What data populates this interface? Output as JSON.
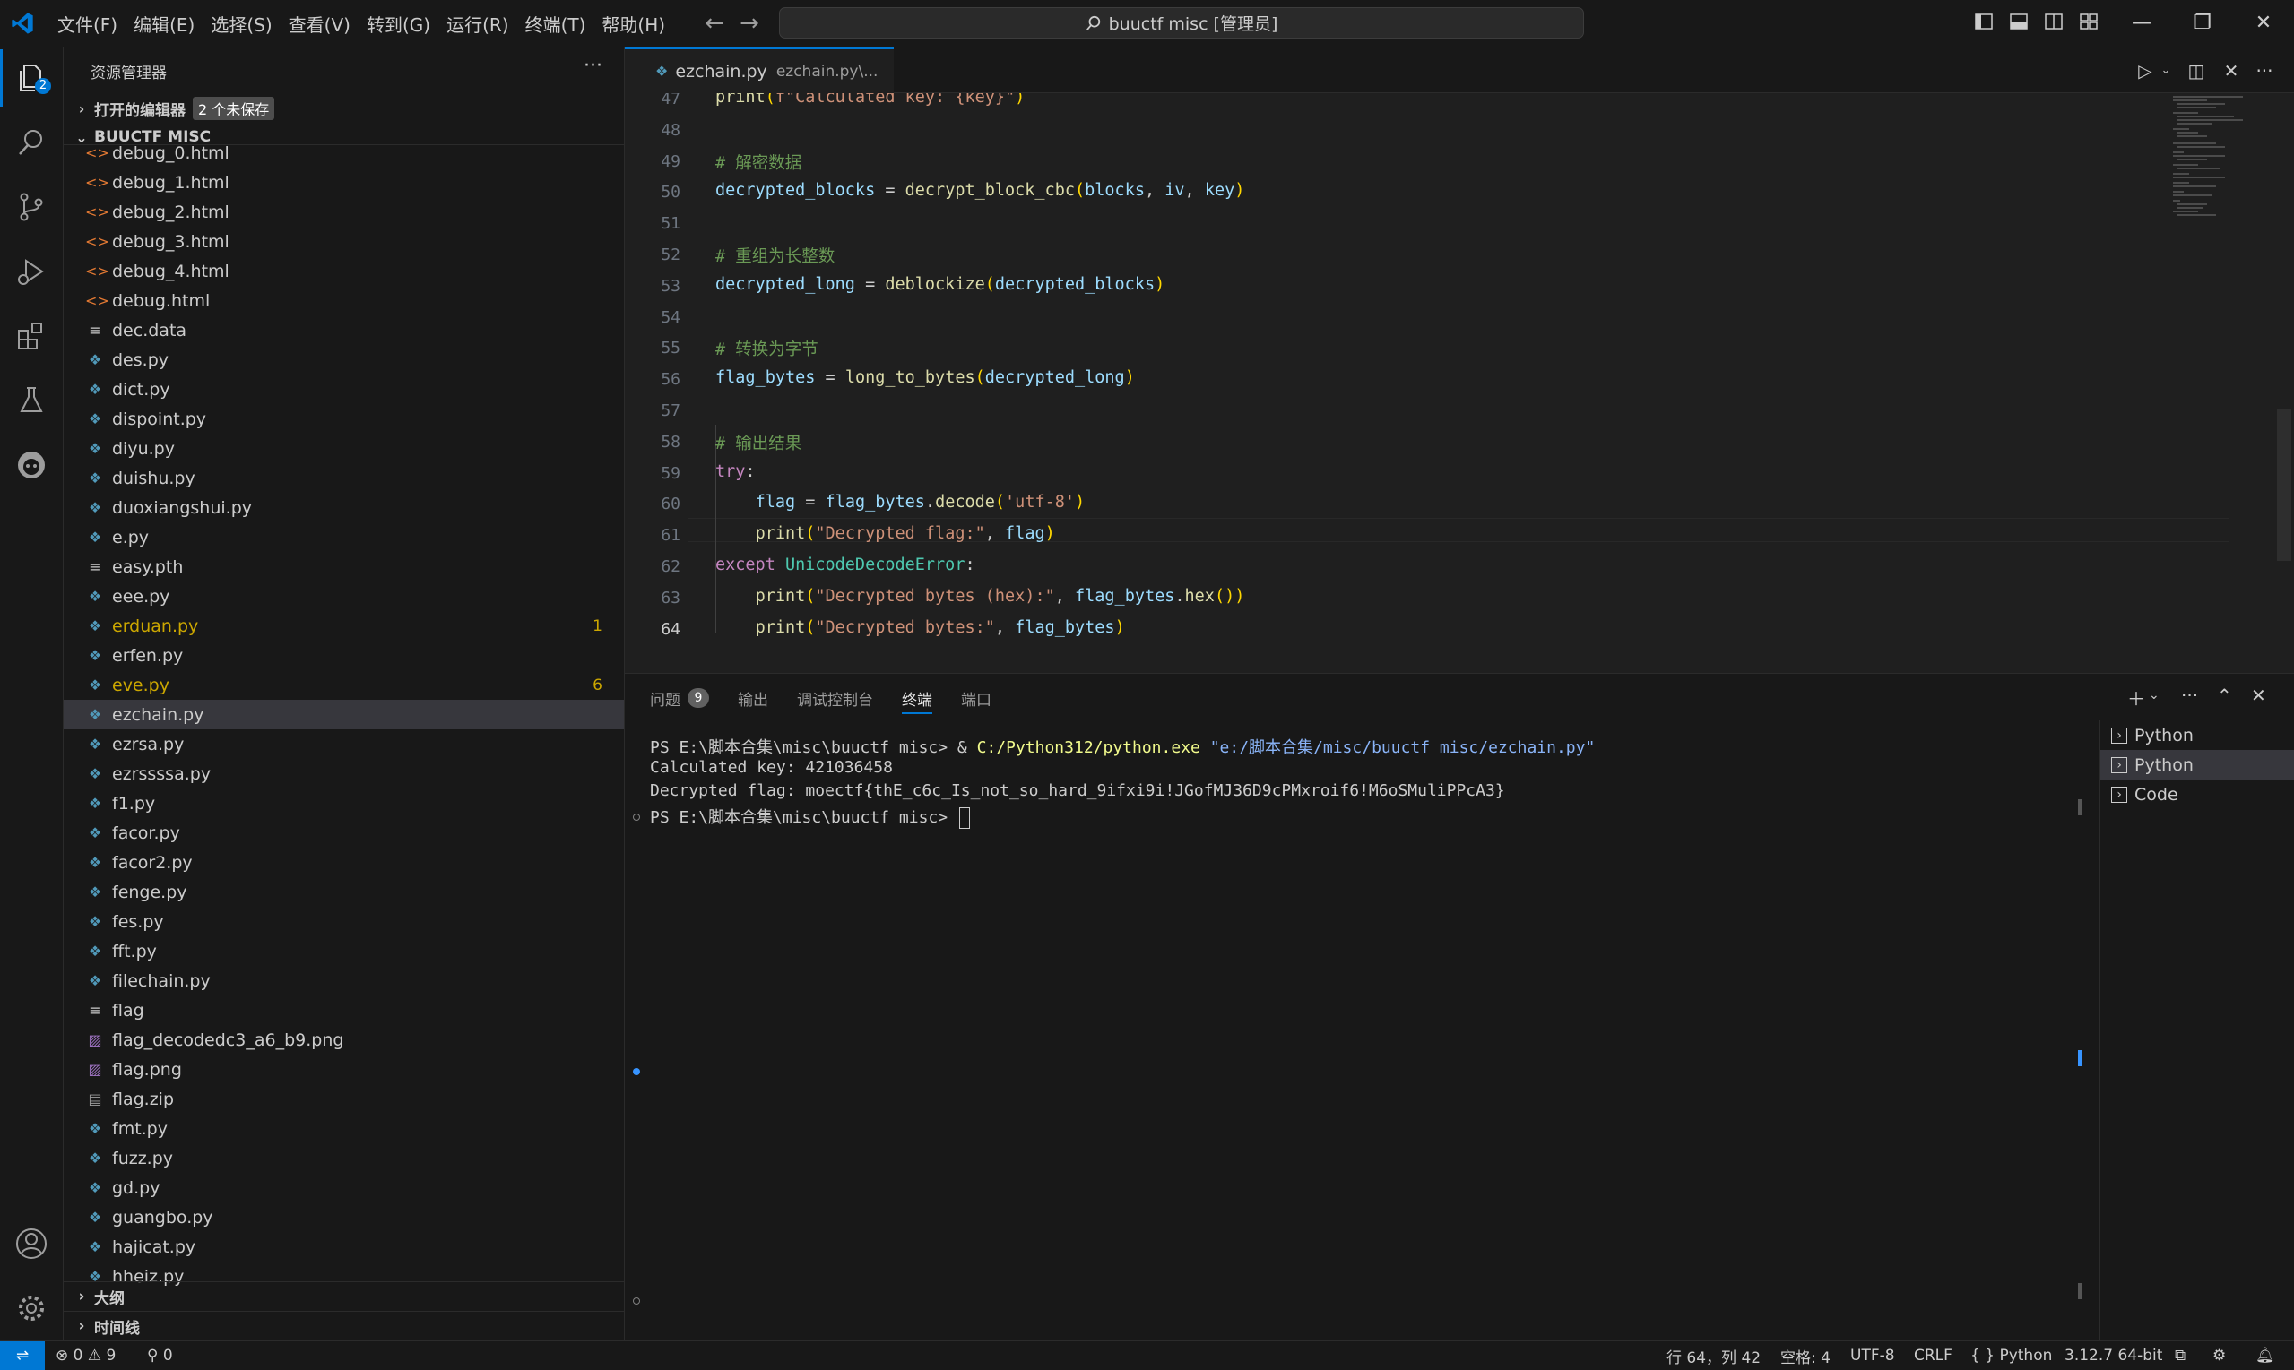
{
  "menu": [
    "文件(F)",
    "编辑(E)",
    "选择(S)",
    "查看(V)",
    "转到(G)",
    "运行(R)",
    "终端(T)",
    "帮助(H)"
  ],
  "command_center": "buuctf misc [管理员]",
  "activity_badge": "2",
  "sidebar": {
    "title": "资源管理器",
    "open_editors": "打开的编辑器",
    "unsaved": "2 个未保存",
    "folder": "BUUCTF MISC",
    "files": [
      {
        "name": "debug_0.html",
        "type": "html",
        "count": ""
      },
      {
        "name": "debug_1.html",
        "type": "html",
        "count": ""
      },
      {
        "name": "debug_2.html",
        "type": "html",
        "count": ""
      },
      {
        "name": "debug_3.html",
        "type": "html",
        "count": ""
      },
      {
        "name": "debug_4.html",
        "type": "html",
        "count": ""
      },
      {
        "name": "debug.html",
        "type": "html",
        "count": ""
      },
      {
        "name": "dec.data",
        "type": "txt",
        "count": ""
      },
      {
        "name": "des.py",
        "type": "py",
        "count": ""
      },
      {
        "name": "dict.py",
        "type": "py",
        "count": ""
      },
      {
        "name": "dispoint.py",
        "type": "py",
        "count": ""
      },
      {
        "name": "diyu.py",
        "type": "py",
        "count": ""
      },
      {
        "name": "duishu.py",
        "type": "py",
        "count": ""
      },
      {
        "name": "duoxiangshui.py",
        "type": "py",
        "count": ""
      },
      {
        "name": "e.py",
        "type": "py",
        "count": ""
      },
      {
        "name": "easy.pth",
        "type": "txt",
        "count": ""
      },
      {
        "name": "eee.py",
        "type": "py",
        "count": ""
      },
      {
        "name": "erduan.py",
        "type": "py",
        "count": "1",
        "warn": true
      },
      {
        "name": "erfen.py",
        "type": "py",
        "count": ""
      },
      {
        "name": "eve.py",
        "type": "py",
        "count": "6",
        "warn": true
      },
      {
        "name": "ezchain.py",
        "type": "py",
        "count": "",
        "selected": true
      },
      {
        "name": "ezrsa.py",
        "type": "py",
        "count": ""
      },
      {
        "name": "ezrssssa.py",
        "type": "py",
        "count": ""
      },
      {
        "name": "f1.py",
        "type": "py",
        "count": ""
      },
      {
        "name": "facor.py",
        "type": "py",
        "count": ""
      },
      {
        "name": "facor2.py",
        "type": "py",
        "count": ""
      },
      {
        "name": "fenge.py",
        "type": "py",
        "count": ""
      },
      {
        "name": "fes.py",
        "type": "py",
        "count": ""
      },
      {
        "name": "fft.py",
        "type": "py",
        "count": ""
      },
      {
        "name": "filechain.py",
        "type": "py",
        "count": ""
      },
      {
        "name": "flag",
        "type": "txt",
        "count": ""
      },
      {
        "name": "flag_decodedc3_a6_b9.png",
        "type": "img",
        "count": ""
      },
      {
        "name": "flag.png",
        "type": "img",
        "count": ""
      },
      {
        "name": "flag.zip",
        "type": "zip",
        "count": ""
      },
      {
        "name": "fmt.py",
        "type": "py",
        "count": ""
      },
      {
        "name": "fuzz.py",
        "type": "py",
        "count": ""
      },
      {
        "name": "gd.py",
        "type": "py",
        "count": ""
      },
      {
        "name": "guangbo.py",
        "type": "py",
        "count": ""
      },
      {
        "name": "hajicat.py",
        "type": "py",
        "count": ""
      },
      {
        "name": "hheiz.py",
        "type": "py",
        "count": ""
      }
    ],
    "outline": "大纲",
    "timeline": "时间线"
  },
  "editor": {
    "tab_name": "ezchain.py",
    "tab_path": "ezchain.py\\...",
    "lines": [
      {
        "n": "47",
        "text": "print(f\"Calculated key: {key}\")"
      },
      {
        "n": "48",
        "text": ""
      },
      {
        "n": "49",
        "text": "# 解密数据"
      },
      {
        "n": "50",
        "text": "decrypted_blocks = decrypt_block_cbc(blocks, iv, key)"
      },
      {
        "n": "51",
        "text": ""
      },
      {
        "n": "52",
        "text": "# 重组为长整数"
      },
      {
        "n": "53",
        "text": "decrypted_long = deblockize(decrypted_blocks)"
      },
      {
        "n": "54",
        "text": ""
      },
      {
        "n": "55",
        "text": "# 转换为字节"
      },
      {
        "n": "56",
        "text": "flag_bytes = long_to_bytes(decrypted_long)"
      },
      {
        "n": "57",
        "text": ""
      },
      {
        "n": "58",
        "text": "# 输出结果"
      },
      {
        "n": "59",
        "text": "try:"
      },
      {
        "n": "60",
        "text": "    flag = flag_bytes.decode('utf-8')"
      },
      {
        "n": "61",
        "text": "    print(\"Decrypted flag:\", flag)"
      },
      {
        "n": "62",
        "text": "except UnicodeDecodeError:"
      },
      {
        "n": "63",
        "text": "    print(\"Decrypted bytes (hex):\", flag_bytes.hex())"
      },
      {
        "n": "64",
        "text": "    print(\"Decrypted bytes:\", flag_bytes)"
      }
    ]
  },
  "panel": {
    "tabs": [
      "问题",
      "输出",
      "调试控制台",
      "终端",
      "端口"
    ],
    "problems_count": "9",
    "active_tab": "终端",
    "terminal": {
      "line1_prompt": "PS E:\\脚本合集\\misc\\buuctf misc> & ",
      "line1_exe": "C:/Python312/python.exe",
      "line1_arg": " \"e:/脚本合集/misc/buuctf misc/ezchain.py\"",
      "line2": "Calculated key: 421036458",
      "line3": "Decrypted flag: moectf{thE_c6c_Is_not_so_hard_9ifxi9i!JGofMJ36D9cPMxroif6!M6oSMuliPPcA3}",
      "line4": "PS E:\\脚本合集\\misc\\buuctf misc> "
    },
    "terminals": [
      "Python",
      "Python",
      "Code"
    ]
  },
  "status": {
    "errors": "0",
    "warnings": "9",
    "ports": "0",
    "position": "行 64，列 42",
    "spaces": "空格: 4",
    "encoding": "UTF-8",
    "eol": "CRLF",
    "language": "Python",
    "interpreter": "3.12.7 64-bit"
  }
}
